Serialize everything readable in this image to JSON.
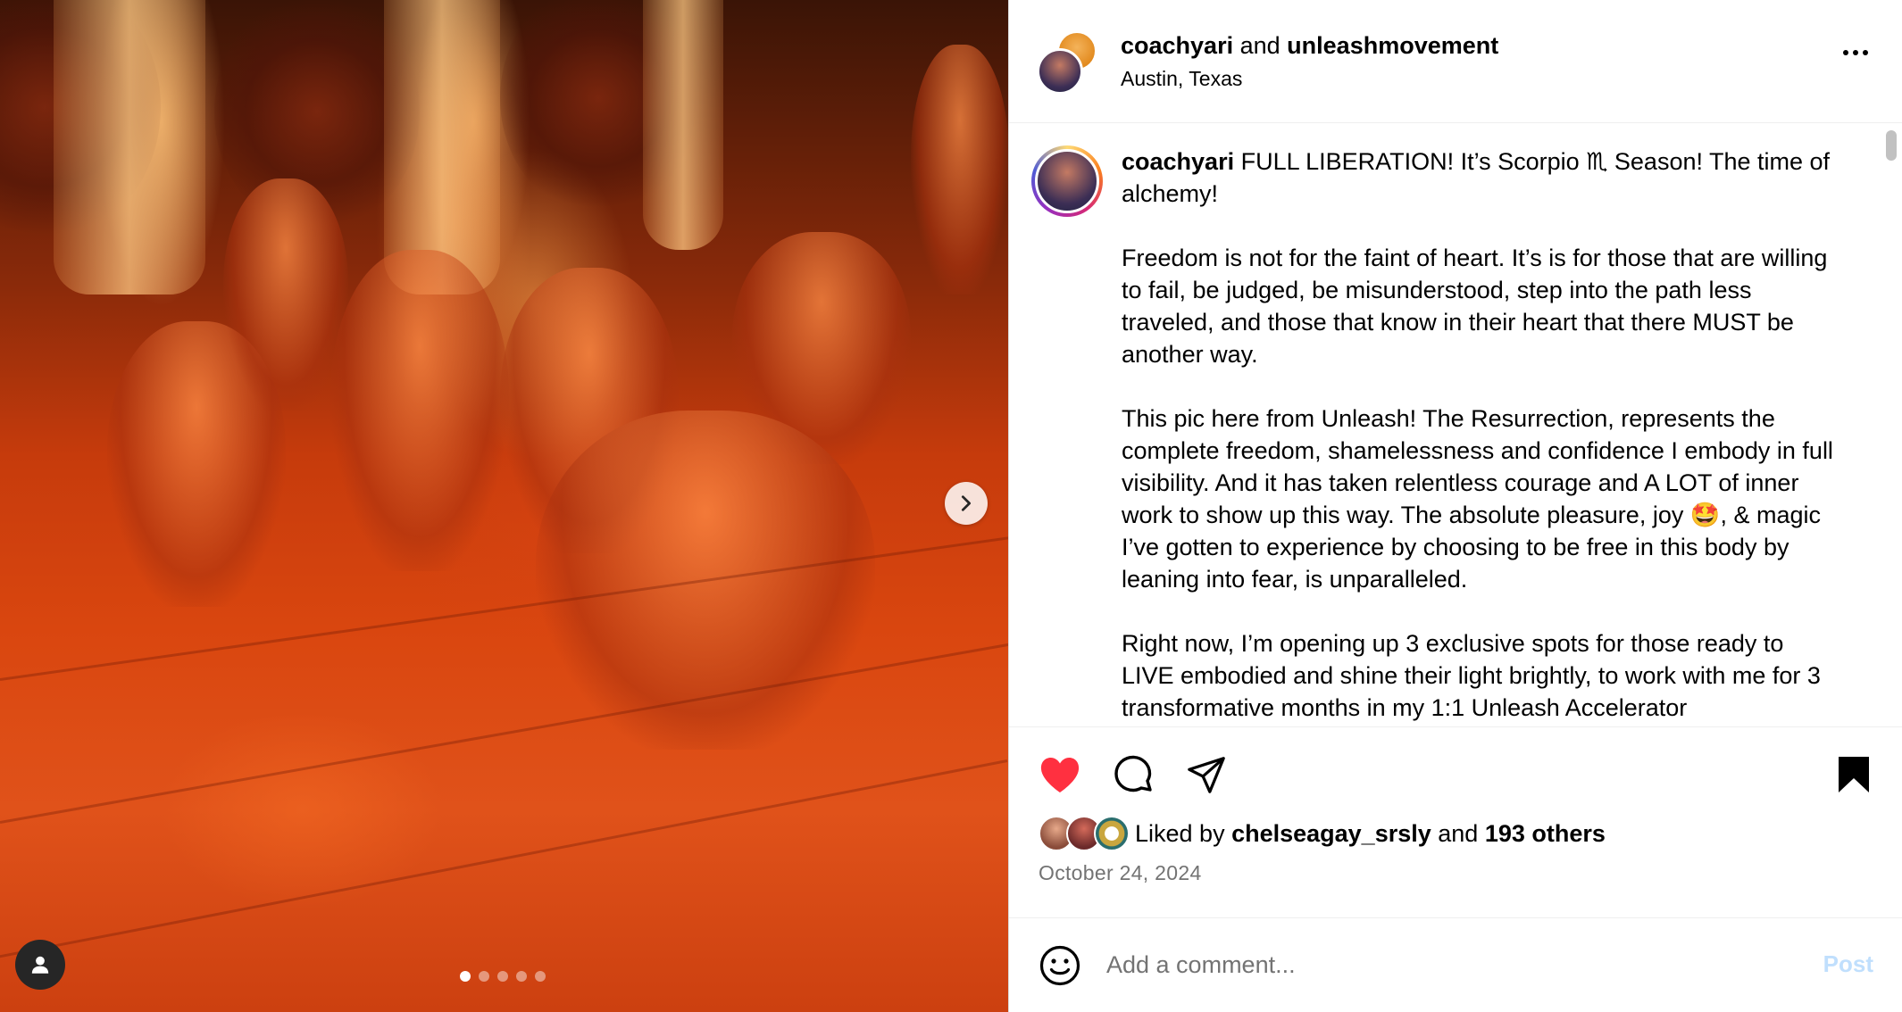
{
  "header": {
    "author": "coachyari",
    "conjunction": "and",
    "coauthor": "unleashmovement",
    "location": "Austin, Texas",
    "more_icon": "more-horizontal-icon"
  },
  "caption": {
    "username": "coachyari",
    "line1": " FULL LIBERATION! It’s Scorpio ♏ Season! The time of alchemy!",
    "para2": "Freedom is not for the faint of heart. It’s is for those that are willing to fail, be judged, be misunderstood, step into the path less traveled, and those that know in their heart that there MUST be another way.",
    "para3": "This pic here from Unleash! The Resurrection, represents the complete freedom, shamelessness and confidence I embody in full visibility. And it has taken relentless courage and A LOT of inner work to show up this way. The absolute pleasure, joy 🤩, & magic I’ve gotten to experience by choosing to be free in this body by leaning into fear, is unparalleled.",
    "para4": "Right now, I’m opening up 3 exclusive spots for those ready to LIVE embodied and shine their light brightly, to work with me for 3 transformative months in my 1:1 Unleash Accelerator"
  },
  "actions": {
    "like_icon": "heart-filled-icon",
    "comment_icon": "comment-icon",
    "share_icon": "send-icon",
    "save_icon": "bookmark-filled-icon",
    "like_color": "#ff3040"
  },
  "likes": {
    "prefix": "Liked by ",
    "user": "chelseagay_srsly",
    "middle": " and ",
    "others": "193 others"
  },
  "date": "October 24, 2024",
  "comment": {
    "placeholder": "Add a comment...",
    "post_label": "Post",
    "emoji_icon": "smiley-icon"
  },
  "media": {
    "slide_count": 5,
    "active_slide": 1,
    "next_icon": "chevron-right-icon",
    "tag_icon": "user-tag-icon"
  }
}
